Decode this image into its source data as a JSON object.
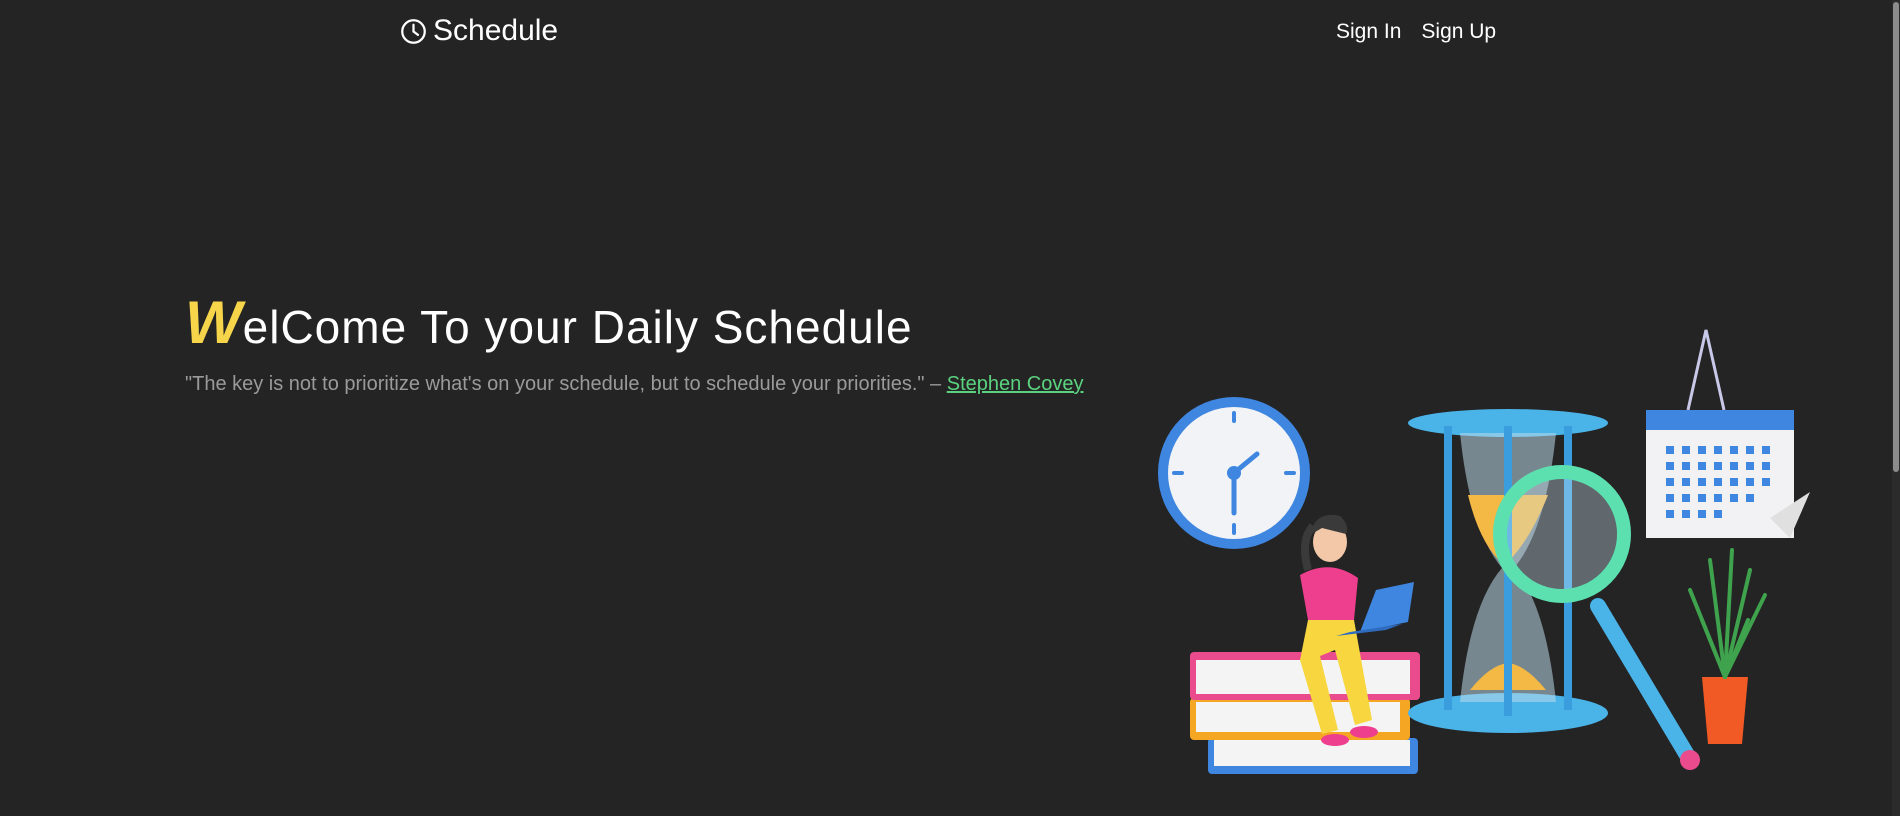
{
  "header": {
    "brand": "Schedule",
    "brand_icon": "clock-icon",
    "nav": {
      "sign_in": "Sign In",
      "sign_up": "Sign Up"
    }
  },
  "hero": {
    "title_first_letter": "W",
    "title_rest": "elCome To your Daily Schedule",
    "quote_text": "\"The key is not to prioritize what's on your schedule, but to schedule your priorities.\" – ",
    "quote_author": "Stephen Covey"
  },
  "colors": {
    "background": "#242424",
    "accent_yellow": "#f7d54a",
    "link_green": "#5ad27f",
    "muted_text": "#9a9a9a"
  }
}
